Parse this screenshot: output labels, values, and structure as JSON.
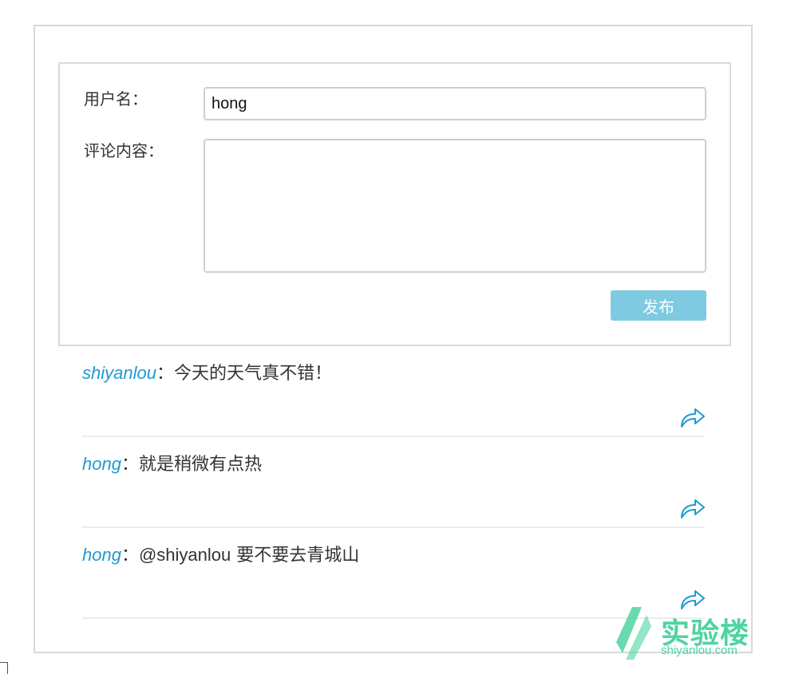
{
  "form": {
    "username_label": "用户名：",
    "username_value": "hong",
    "comment_label": "评论内容：",
    "comment_value": "",
    "publish_label": "发布"
  },
  "comments": [
    {
      "author": "shiyanlou",
      "separator": "：",
      "text": "今天的天气真不错！",
      "mention": "",
      "icon": "reply-arrow-icon"
    },
    {
      "author": "hong",
      "separator": "：",
      "text": "就是稍微有点热",
      "mention": "",
      "icon": "reply-arrow-icon"
    },
    {
      "author": "hong",
      "separator": "：",
      "mention": "@shiyanlou",
      "text": "要不要去青城山",
      "icon": "reply-arrow-icon"
    }
  ],
  "watermark": {
    "cn": "实验楼",
    "en": "shiyanlou.com"
  },
  "colors": {
    "accent": "#1e9ad0",
    "button": "#7ecbe1",
    "logo": "#4fd3a2",
    "border": "#d9d9d9"
  }
}
